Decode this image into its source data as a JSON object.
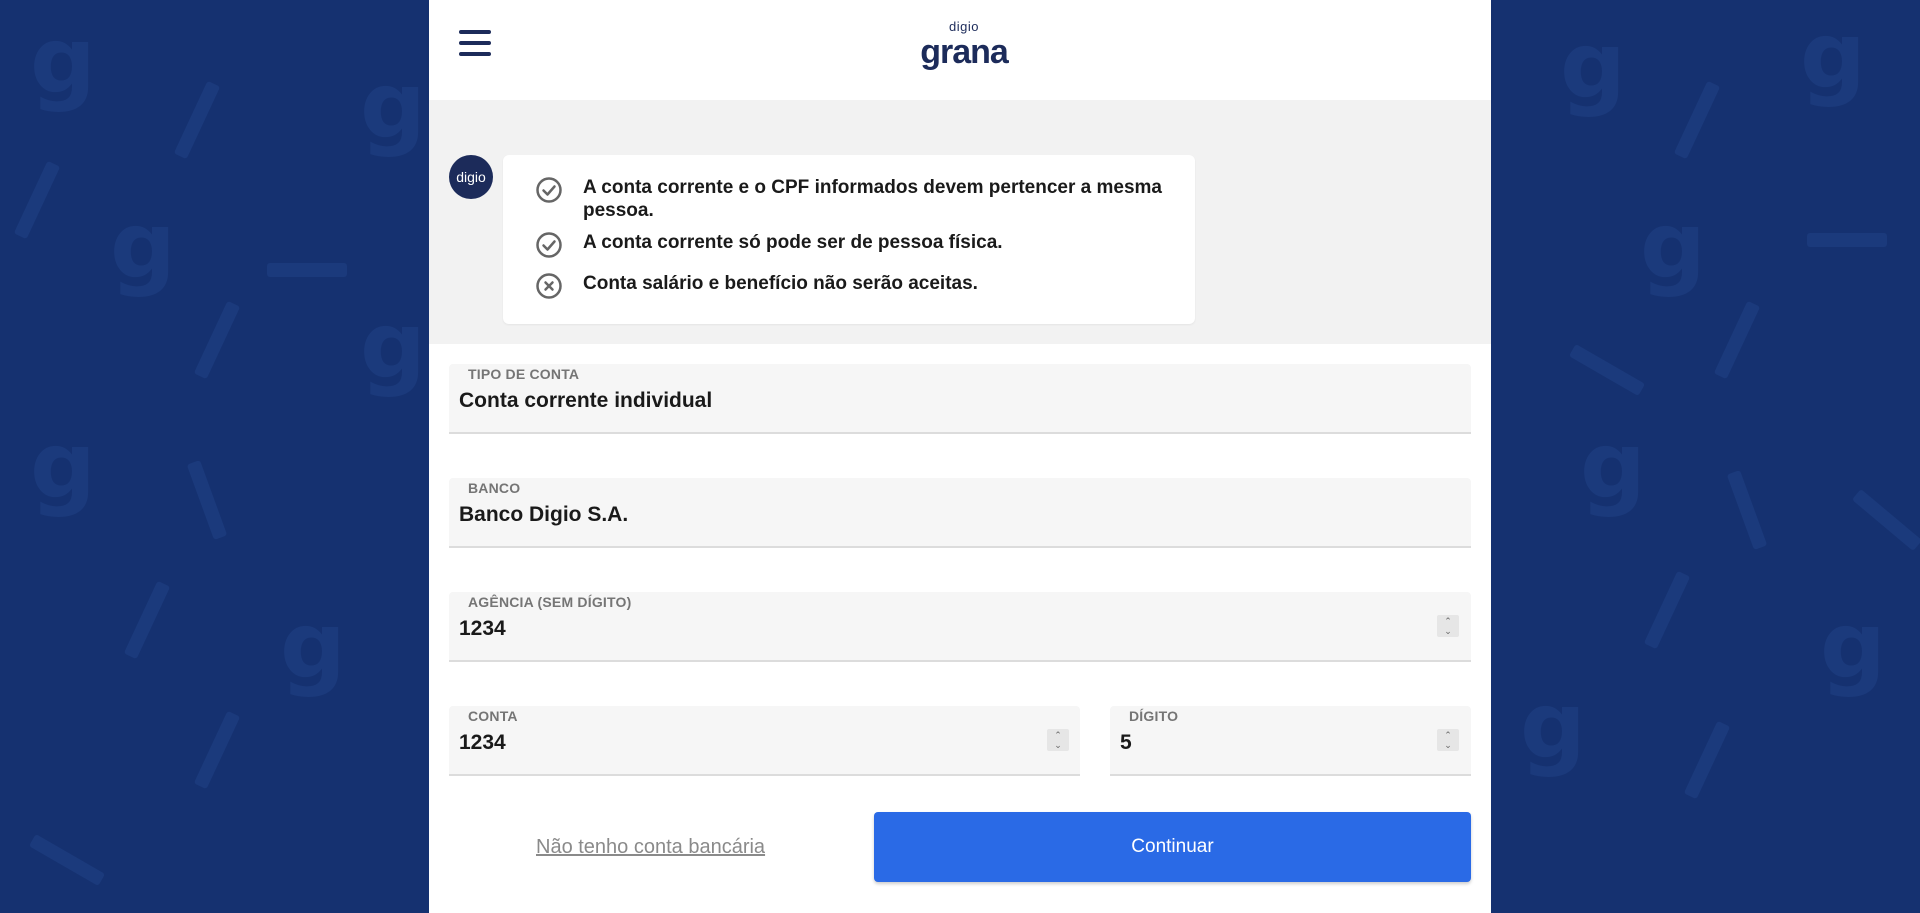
{
  "colors": {
    "background": "#153170",
    "brand": "#1c2b5a",
    "primary_button": "#2a6ae6",
    "pattern": "#1b3a7c"
  },
  "header": {
    "menu_icon": "hamburger-menu-icon",
    "logo_small": "digio",
    "logo_big": "grana"
  },
  "chat": {
    "avatar_label": "digio",
    "items": [
      {
        "icon": "check-circle-icon",
        "text": "A conta corrente e o CPF informados devem pertencer a mesma pessoa."
      },
      {
        "icon": "check-circle-icon",
        "text": "A conta corrente só pode ser de pessoa física."
      },
      {
        "icon": "x-circle-icon",
        "text": "Conta salário e benefício não serão aceitas."
      }
    ]
  },
  "form": {
    "account_type": {
      "label": "TIPO DE CONTA",
      "value": "Conta corrente individual"
    },
    "bank": {
      "label": "BANCO",
      "value": "Banco Digio S.A."
    },
    "agency": {
      "label": "AGÊNCIA (SEM DÍGITO)",
      "value": "1234"
    },
    "account": {
      "label": "CONTA",
      "value": "1234"
    },
    "digit": {
      "label": "DÍGITO",
      "value": "5"
    }
  },
  "actions": {
    "no_account_link": "Não tenho conta bancária",
    "continue_button": "Continuar"
  }
}
